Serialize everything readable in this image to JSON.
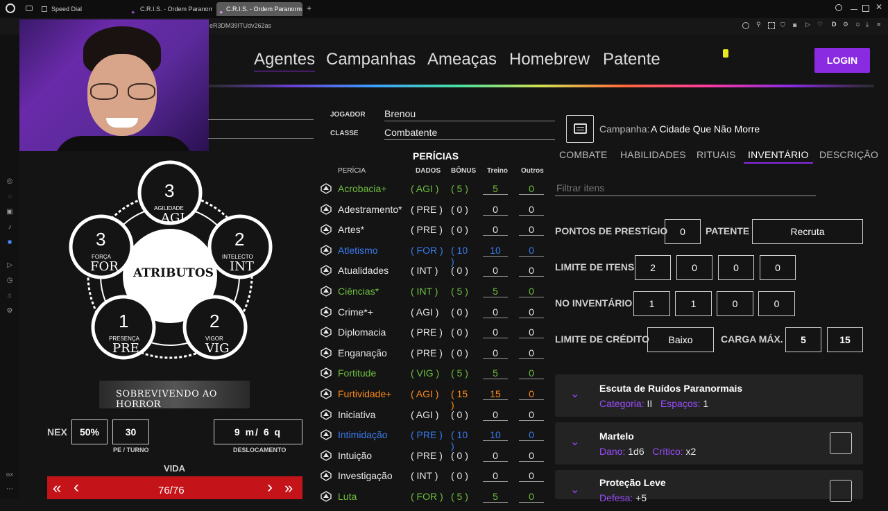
{
  "browser": {
    "tabs": [
      {
        "label": "Speed Dial"
      },
      {
        "label": "C.R.I.S. - Ordem Paranormal"
      },
      {
        "label": "C.R.I.S. - Ordem Paranormal"
      }
    ],
    "new_tab": "+",
    "url_fragment": "eR3DM39ITUdv262as"
  },
  "nav": {
    "items": [
      "Agentes",
      "Campanhas",
      "Ameaças",
      "Homebrew",
      "Patente"
    ],
    "login": "LOGIN"
  },
  "header": {
    "jogador_label": "JOGADOR",
    "jogador_value": "Brenou",
    "classe_label": "CLASSE",
    "classe_value": "Combatente",
    "campanha_label": "Campanha:",
    "campanha_value": "A Cidade Que Não Morre"
  },
  "attributes": {
    "center": "ATRIBUTOS",
    "agi": {
      "value": "3",
      "label": "AGILIDADE",
      "abbr": "AGI"
    },
    "for": {
      "value": "3",
      "label": "FORÇA",
      "abbr": "FOR"
    },
    "int": {
      "value": "2",
      "label": "INTELECTO",
      "abbr": "INT"
    },
    "pre": {
      "value": "1",
      "label": "PRESENÇA",
      "abbr": "PRE"
    },
    "vig": {
      "value": "2",
      "label": "VIGOR",
      "abbr": "VIG"
    },
    "banner": "SOBREVIVENDO AO HORROR"
  },
  "stats": {
    "nex_label": "NEX",
    "nex_value": "50%",
    "pe_value": "30",
    "pe_label": "PE / TURNO",
    "desloc_value": "9 m/ 6 q",
    "desloc_label": "DESLOCAMENTO",
    "vida_label": "VIDA",
    "vida_value": "76/76",
    "vida_btns": [
      "«",
      "‹",
      "›",
      "»"
    ]
  },
  "skills": {
    "title": "PERÍCIAS",
    "headers": [
      "PERÍCIA",
      "DADOS",
      "BÔNUS",
      "Treino",
      "Outros"
    ],
    "rows": [
      {
        "name": "Acrobacia+",
        "dado": "( AGI )",
        "bonus": "( 5 )",
        "treino": "5",
        "outros": "0",
        "color": "green"
      },
      {
        "name": "Adestramento*",
        "dado": "( PRE )",
        "bonus": "( 0 )",
        "treino": "0",
        "outros": "0",
        "color": "white"
      },
      {
        "name": "Artes*",
        "dado": "( PRE )",
        "bonus": "( 0 )",
        "treino": "0",
        "outros": "0",
        "color": "white"
      },
      {
        "name": "Atletismo",
        "dado": "( FOR )",
        "bonus": "( 10 )",
        "treino": "10",
        "outros": "0",
        "color": "blue"
      },
      {
        "name": "Atualidades",
        "dado": "( INT )",
        "bonus": "( 0 )",
        "treino": "0",
        "outros": "0",
        "color": "white"
      },
      {
        "name": "Ciências*",
        "dado": "( INT )",
        "bonus": "( 5 )",
        "treino": "5",
        "outros": "0",
        "color": "green"
      },
      {
        "name": "Crime*+",
        "dado": "( AGI )",
        "bonus": "( 0 )",
        "treino": "0",
        "outros": "0",
        "color": "white"
      },
      {
        "name": "Diplomacia",
        "dado": "( PRE )",
        "bonus": "( 0 )",
        "treino": "0",
        "outros": "0",
        "color": "white"
      },
      {
        "name": "Enganação",
        "dado": "( PRE )",
        "bonus": "( 0 )",
        "treino": "0",
        "outros": "0",
        "color": "white"
      },
      {
        "name": "Fortitude",
        "dado": "( VIG )",
        "bonus": "( 5 )",
        "treino": "5",
        "outros": "0",
        "color": "green"
      },
      {
        "name": "Furtividade+",
        "dado": "( AGI )",
        "bonus": "( 15 )",
        "treino": "15",
        "outros": "0",
        "color": "orange"
      },
      {
        "name": "Iniciativa",
        "dado": "( AGI )",
        "bonus": "( 0 )",
        "treino": "0",
        "outros": "0",
        "color": "white"
      },
      {
        "name": "Intimidação",
        "dado": "( PRE )",
        "bonus": "( 10 )",
        "treino": "10",
        "outros": "0",
        "color": "blue"
      },
      {
        "name": "Intuição",
        "dado": "( PRE )",
        "bonus": "( 0 )",
        "treino": "0",
        "outros": "0",
        "color": "white"
      },
      {
        "name": "Investigação",
        "dado": "( INT )",
        "bonus": "( 0 )",
        "treino": "0",
        "outros": "0",
        "color": "white"
      },
      {
        "name": "Luta",
        "dado": "( FOR )",
        "bonus": "( 5 )",
        "treino": "5",
        "outros": "0",
        "color": "green"
      }
    ]
  },
  "right": {
    "tabs": [
      "COMBATE",
      "HABILIDADES",
      "RITUAIS",
      "INVENTÁRIO",
      "DESCRIÇÃO"
    ],
    "active_tab": "INVENTÁRIO",
    "filter_placeholder": "Filtrar itens",
    "prestigio_label": "PONTOS DE PRESTÍGIO",
    "prestigio_value": "0",
    "patente_label": "PATENTE",
    "patente_value": "Recruta",
    "limite_itens_label": "LIMITE DE ITENS",
    "limite_itens": [
      "2",
      "0",
      "0",
      "0"
    ],
    "no_inventario_label": "NO INVENTÁRIO",
    "no_inventario": [
      "1",
      "1",
      "0",
      "0"
    ],
    "limite_credito_label": "LIMITE DE CRÉDITO",
    "limite_credito_value": "Baixo",
    "carga_label": "CARGA MÁX.",
    "carga_values": [
      "5",
      "15"
    ],
    "items": [
      {
        "title": "Escuta de Ruídos Paranormais",
        "k1": "Categoria:",
        "v1": "II",
        "k2": "Espaços:",
        "v2": "1"
      },
      {
        "title": "Martelo",
        "k1": "Dano:",
        "v1": "1d6",
        "k2": "Crítico:",
        "v2": "x2"
      },
      {
        "title": "Proteção Leve",
        "k1": "Defesa:",
        "v1": "+5",
        "k2": "",
        "v2": ""
      }
    ]
  },
  "colors": {
    "accent": "#8a2be2",
    "vida": "#c4141a",
    "green": "#6fbf3f",
    "blue": "#3a7bf0",
    "orange": "#ff8c1a"
  }
}
